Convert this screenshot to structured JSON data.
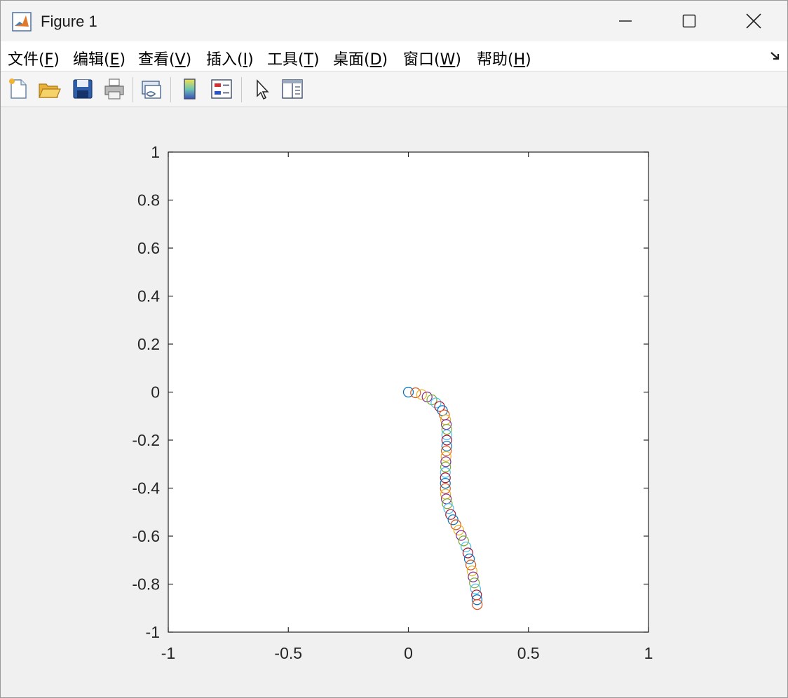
{
  "window": {
    "title": "Figure 1"
  },
  "menu": [
    {
      "text": "文件(",
      "key": "F",
      "tail": ")"
    },
    {
      "text": "编辑(",
      "key": "E",
      "tail": ")"
    },
    {
      "text": "查看(",
      "key": "V",
      "tail": ")"
    },
    {
      "text": "插入(",
      "key": "I",
      "tail": ")"
    },
    {
      "text": "工具(",
      "key": "T",
      "tail": ")"
    },
    {
      "text": "桌面(",
      "key": "D",
      "tail": ")"
    },
    {
      "text": "窗口(",
      "key": "W",
      "tail": ")"
    },
    {
      "text": "帮助(",
      "key": "H",
      "tail": ")"
    }
  ],
  "toolbar": {
    "icons": [
      "new-figure-icon",
      "open-file-icon",
      "save-icon",
      "print-icon",
      "link-plot-icon",
      "colorbar-icon",
      "legend-icon",
      "edit-plot-arrow-icon",
      "property-inspector-icon"
    ]
  },
  "chart_data": {
    "type": "scatter",
    "marker": "o",
    "xlim": [
      -1,
      1
    ],
    "ylim": [
      -1,
      1
    ],
    "xticks": [
      "-1",
      "-0.5",
      "0",
      "0.5",
      "1"
    ],
    "yticks": [
      "1",
      "0.8",
      "0.6",
      "0.4",
      "0.2",
      "0",
      "-0.2",
      "-0.4",
      "-0.6",
      "-0.8",
      "-1"
    ],
    "xtick_values": [
      -1,
      -0.5,
      0,
      0.5,
      1
    ],
    "ytick_values": [
      1,
      0.8,
      0.6,
      0.4,
      0.2,
      0,
      -0.2,
      -0.4,
      -0.6,
      -0.8,
      -1
    ],
    "grid": false,
    "colors": [
      "#0072BD",
      "#D95319",
      "#EDB120",
      "#7E2F8E",
      "#77AC30",
      "#4DBEEE",
      "#A2142F"
    ],
    "points": [
      [
        0.0,
        0.0
      ],
      [
        0.03,
        -0.003
      ],
      [
        0.055,
        -0.01
      ],
      [
        0.078,
        -0.02
      ],
      [
        0.098,
        -0.032
      ],
      [
        0.115,
        -0.045
      ],
      [
        0.13,
        -0.06
      ],
      [
        0.142,
        -0.077
      ],
      [
        0.15,
        -0.095
      ],
      [
        0.155,
        -0.115
      ],
      [
        0.158,
        -0.135
      ],
      [
        0.16,
        -0.155
      ],
      [
        0.16,
        -0.178
      ],
      [
        0.16,
        -0.2
      ],
      [
        0.16,
        -0.225
      ],
      [
        0.158,
        -0.245
      ],
      [
        0.157,
        -0.268
      ],
      [
        0.156,
        -0.29
      ],
      [
        0.155,
        -0.312
      ],
      [
        0.154,
        -0.335
      ],
      [
        0.154,
        -0.357
      ],
      [
        0.154,
        -0.38
      ],
      [
        0.154,
        -0.402
      ],
      [
        0.155,
        -0.425
      ],
      [
        0.158,
        -0.445
      ],
      [
        0.162,
        -0.465
      ],
      [
        0.168,
        -0.485
      ],
      [
        0.176,
        -0.51
      ],
      [
        0.186,
        -0.532
      ],
      [
        0.198,
        -0.553
      ],
      [
        0.21,
        -0.575
      ],
      [
        0.22,
        -0.597
      ],
      [
        0.23,
        -0.62
      ],
      [
        0.24,
        -0.645
      ],
      [
        0.248,
        -0.67
      ],
      [
        0.254,
        -0.695
      ],
      [
        0.26,
        -0.72
      ],
      [
        0.265,
        -0.745
      ],
      [
        0.27,
        -0.77
      ],
      [
        0.275,
        -0.795
      ],
      [
        0.28,
        -0.82
      ],
      [
        0.284,
        -0.845
      ],
      [
        0.286,
        -0.865
      ],
      [
        0.287,
        -0.885
      ]
    ]
  }
}
